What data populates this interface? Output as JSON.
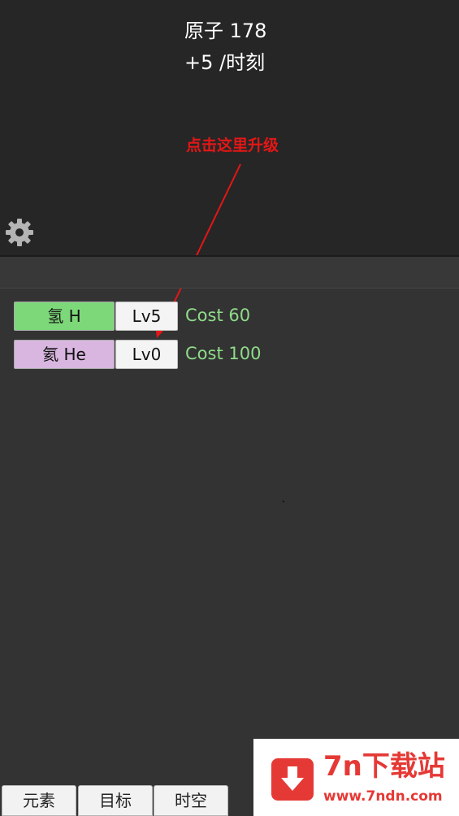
{
  "header": {
    "atoms_label": "原子 178",
    "rate_label": "+5 /时刻"
  },
  "annotation": {
    "text": "点击这里升级",
    "color": "#e41616"
  },
  "settings": {
    "icon": "gear-icon"
  },
  "elements": [
    {
      "name": "氢 H",
      "level": "Lv5",
      "cost": "Cost 60",
      "color": "#7dd87a"
    },
    {
      "name": "氦 He",
      "level": "Lv0",
      "cost": "Cost 100",
      "color": "#d8b6e0"
    }
  ],
  "tabs": [
    {
      "label": "元素"
    },
    {
      "label": "目标"
    },
    {
      "label": "时空"
    }
  ],
  "watermark": {
    "title": "7n下载站",
    "url": "www.7ndn.com",
    "icon": "download-icon",
    "color": "#e53935"
  }
}
